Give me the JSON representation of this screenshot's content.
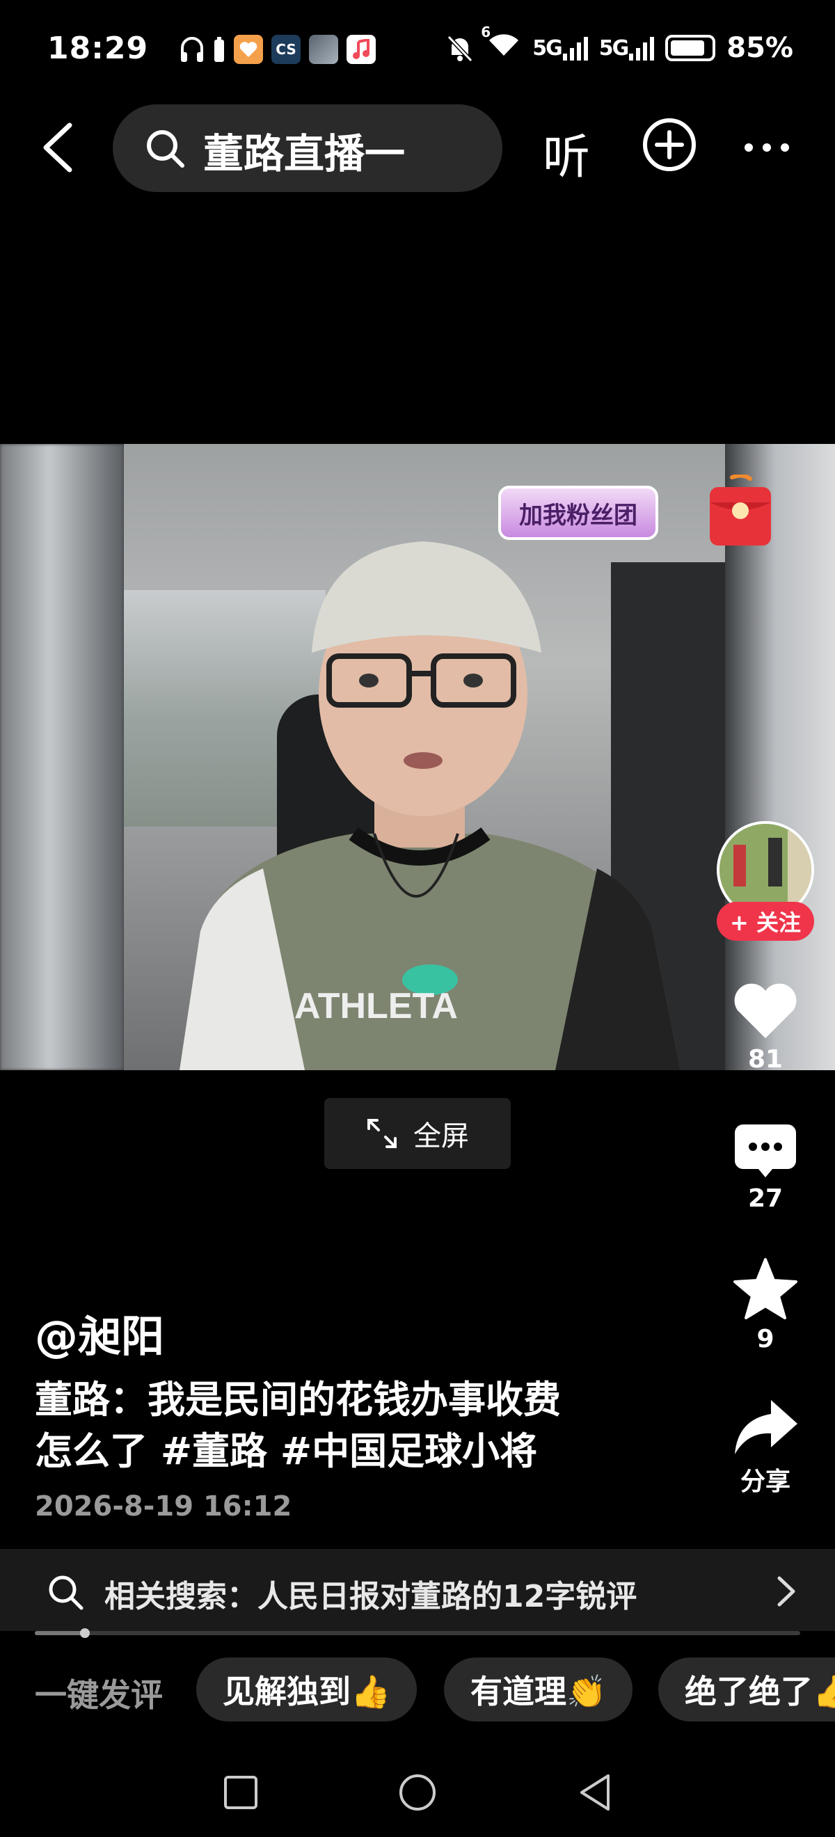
{
  "status_bar": {
    "time": "18:29",
    "app_icons": [
      "headphones-icon",
      "phone-battery-icon",
      "heart-app-icon",
      "cs-app-icon",
      "game-app-icon",
      "music-app-icon"
    ],
    "cs_label": "CS",
    "signal_1": "5G",
    "signal_2": "5G",
    "wifi_badge": "6",
    "battery_percent": "85%",
    "battery_level": 0.85
  },
  "nav": {
    "search_query": "董路直播一",
    "listen_label": "听"
  },
  "video": {
    "fan_badge": "加我粉丝团",
    "shirt_text": "ATHLETA"
  },
  "fullscreen": {
    "label": "全屏"
  },
  "actions": {
    "follow_label": "+ 关注",
    "likes": "81",
    "comments": "27",
    "favorites": "9",
    "share_label": "分享"
  },
  "post": {
    "author": "@昶阳",
    "desc_line1": "董路：我是民间的花钱办事收费",
    "desc_line2_text": "怎么了 ",
    "tag1": "#董路",
    "tag2": "#中国足球小将",
    "date": "2026-8-19 16:12"
  },
  "related": {
    "text": "相关搜索：人民日报对董路的12字锐评"
  },
  "progress": {
    "fraction": 0.065
  },
  "quick_comments": {
    "label": "一键发评",
    "chips": [
      "见解独到👍",
      "有道理👏",
      "绝了绝了👍"
    ]
  },
  "colors": {
    "background": "#000000",
    "follow_red": "#f0354b",
    "chip_bg": "#2a2a2a",
    "search_bg": "#2a2a2a"
  }
}
